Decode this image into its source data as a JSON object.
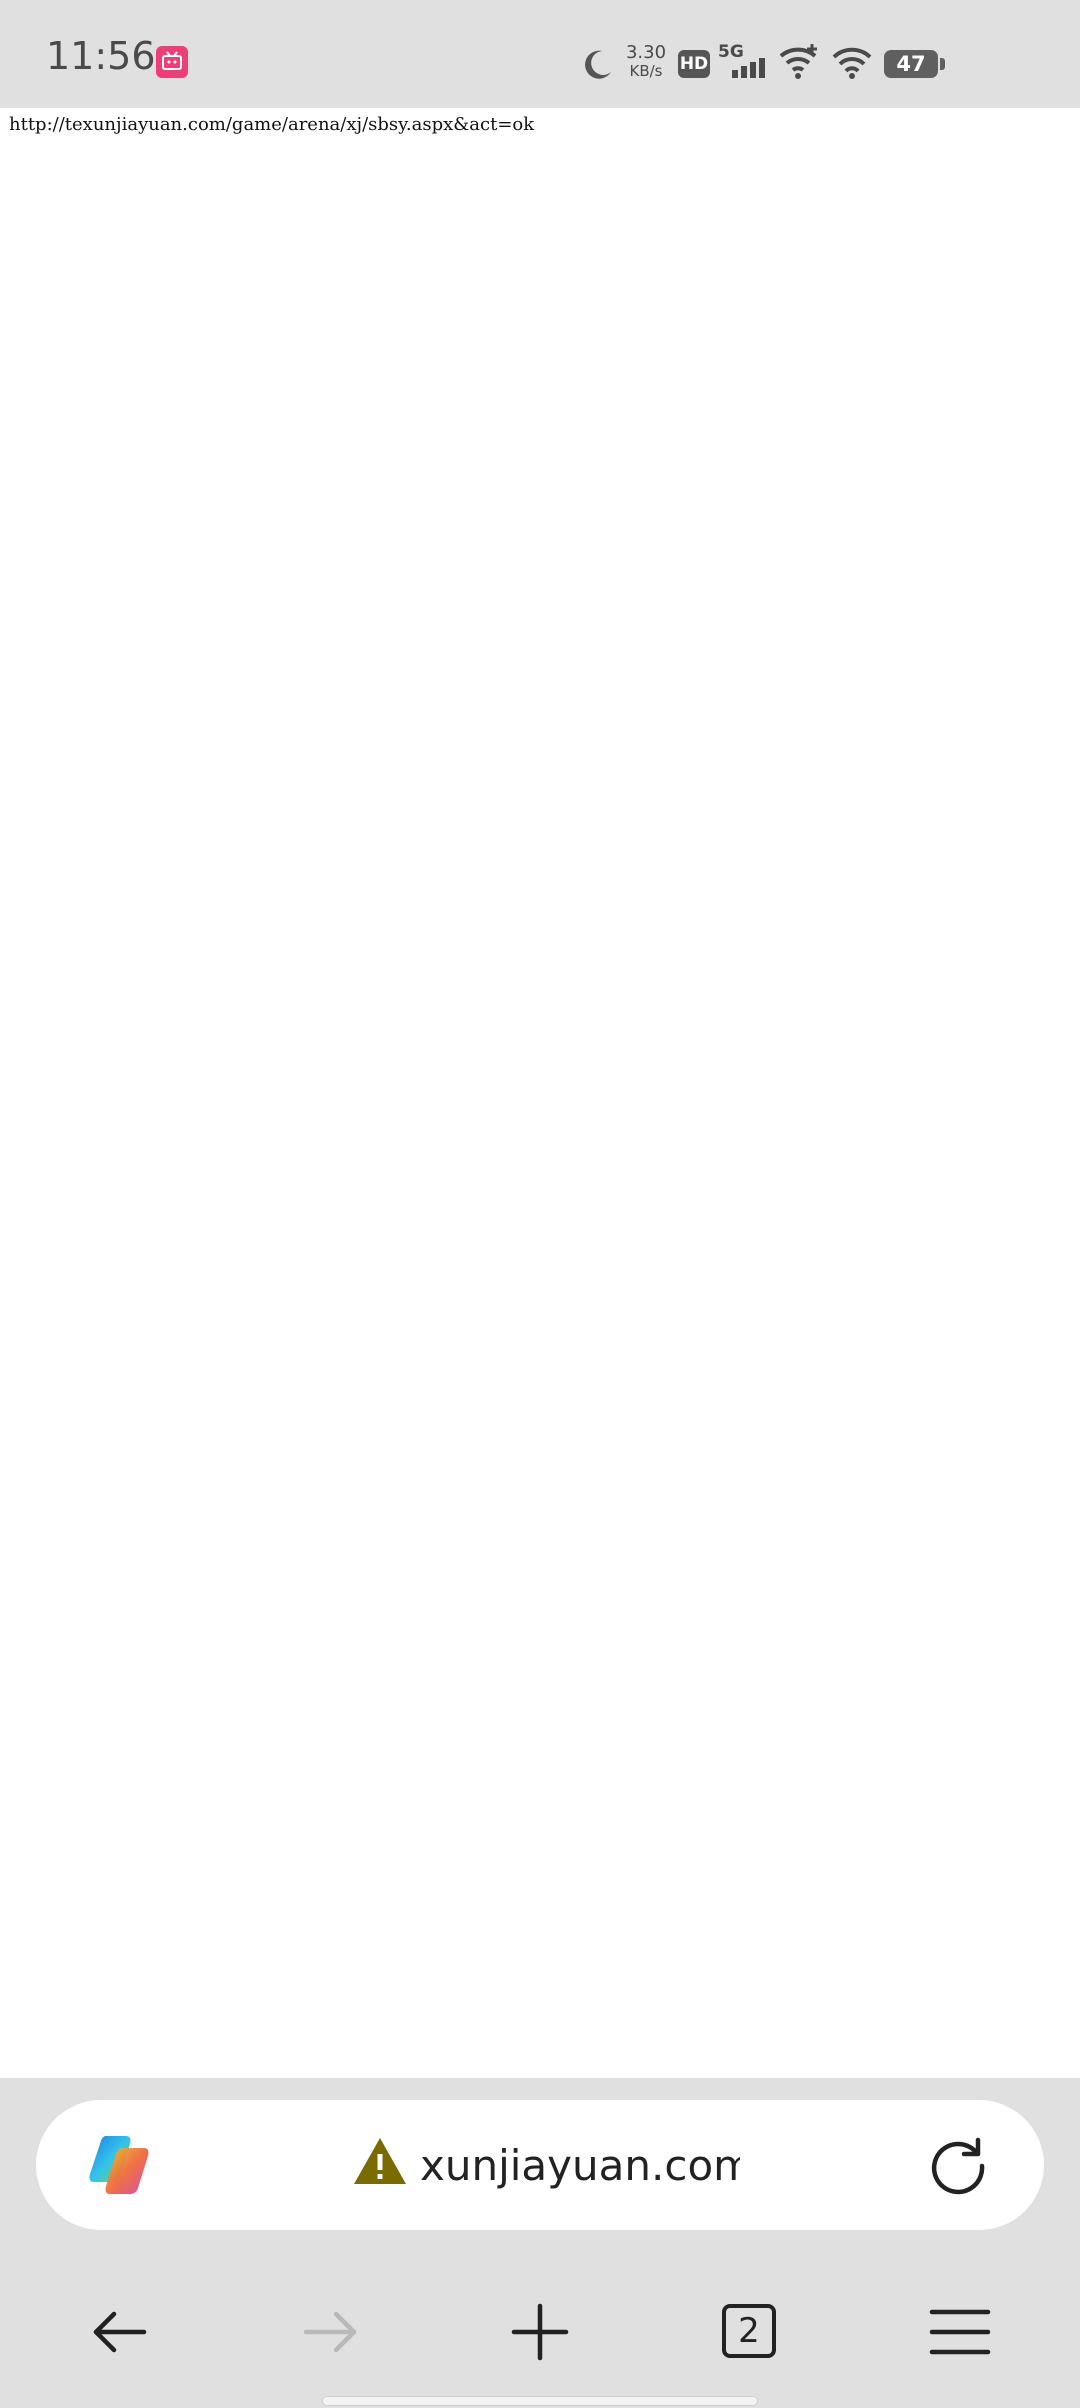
{
  "status_bar": {
    "time": "11:56",
    "speed_value": "3.30",
    "speed_unit": "KB/s",
    "hd_label": "HD",
    "network_label": "5G",
    "battery": "47"
  },
  "page": {
    "url_text": "http://texunjiayuan.com/game/arena/xj/sbsy.aspx&act=ok"
  },
  "address_bar": {
    "display_url": "xunjiayuan.com"
  },
  "toolbar": {
    "tab_count": "2"
  },
  "colors": {
    "status_bar_bg": "#e0e0e0",
    "warning": "#7a6a00",
    "app_notification": "#ec3f78"
  }
}
